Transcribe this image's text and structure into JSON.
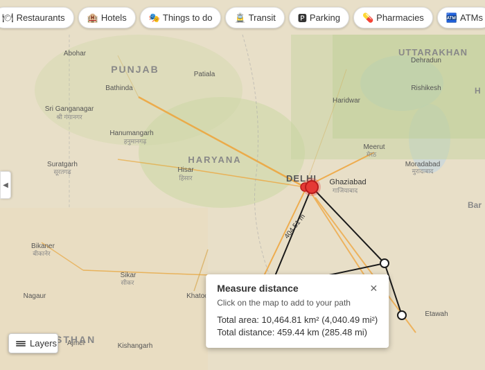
{
  "filterBar": {
    "chips": [
      {
        "id": "restaurants",
        "icon": "🍽",
        "label": "Restaurants"
      },
      {
        "id": "hotels",
        "icon": "🏨",
        "label": "Hotels"
      },
      {
        "id": "things-to-do",
        "icon": "🎭",
        "label": "Things to do"
      },
      {
        "id": "transit",
        "icon": "🚊",
        "label": "Transit"
      },
      {
        "id": "parking",
        "icon": "🅿",
        "label": "Parking"
      },
      {
        "id": "pharmacies",
        "icon": "💊",
        "label": "Pharmacies"
      },
      {
        "id": "atms",
        "icon": "🏧",
        "label": "ATMs"
      }
    ]
  },
  "expandButton": {
    "icon": "◀"
  },
  "layers": {
    "label": "Layers"
  },
  "measurePopup": {
    "title": "Measure distance",
    "subtitle": "Click on the map to add to your path",
    "area_label": "Total area:",
    "area_value": "10,464.81 km² (4,040.49 mi²)",
    "distance_label": "Total distance:",
    "distance_value": "459.44 km (285.48 mi)",
    "close_icon": "✕"
  },
  "mapLabels": {
    "punjab": "PUNJAB",
    "haryana": "HARYANA",
    "delhi": "DELHI",
    "uttarakhan": "UTTARAKHAN",
    "abohar": "Abohar",
    "bathinda": "Bathinda",
    "patiala": "Patiala",
    "sriGanganagar": "Sri Ganganagar",
    "hanumangarh": "Hanumangarh",
    "suratgarh": "Suratgarh",
    "hisar": "Hisar",
    "haridwar": "Haridwar",
    "meerut": "Meerut",
    "ghaziabad": "Ghaziabad",
    "moradabad": "Moradabad",
    "bikaner": "Bikaner",
    "sikar": "Sikar",
    "khatoo": "Khatoo",
    "nagaur": "Nagaur",
    "ajmer": "Ajmer",
    "kishangarh": "Kishangarh",
    "etawah": "Etawah",
    "dehradun": "Dehradun",
    "rishikesh": "Rishikesh"
  }
}
